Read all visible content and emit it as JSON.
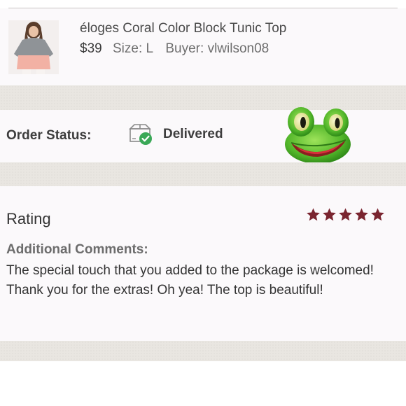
{
  "product": {
    "title": "éloges Coral Color Block Tunic Top",
    "price": "$39",
    "size_label": "Size:",
    "size_value": "L",
    "buyer_label": "Buyer:",
    "buyer_value": "vlwilson08"
  },
  "order": {
    "status_label": "Order Status:",
    "status_value": "Delivered",
    "status_icon": "package-delivered-icon",
    "status_color": "#3aa857"
  },
  "review": {
    "rating_label": "Rating",
    "rating": 5,
    "rating_max": 5,
    "star_color": "#7a2530",
    "comments_label": "Additional Comments:",
    "comments_text": "The special touch that you added to the package is welcomed! Thank you for the extras! Oh yea! The top is beautiful!"
  },
  "decorations": {
    "frog": "frog-emoji-icon"
  }
}
